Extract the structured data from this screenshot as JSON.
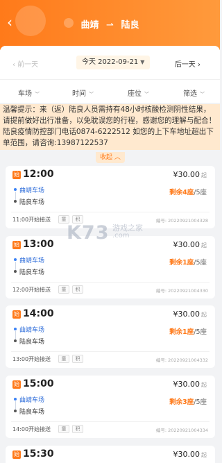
{
  "header": {
    "from_city": "曲靖",
    "arrow": "⇀",
    "to_city": "陆良",
    "back_icon": "chevron-left-icon"
  },
  "date_bar": {
    "prev": "前一天",
    "today": "今天 2022-09-21",
    "next": "后一天"
  },
  "filters": [
    "车场",
    "时间",
    "座位",
    "筛选"
  ],
  "notice": {
    "text": "温馨提示：来（返）陆良人员需持有48小时核酸检测阴性结果，请提前做好出行准备，以免耽误您的行程，感谢您的理解与配合！陆良疫情防控部门电话0874-6222512 如您的上下车地址超出下单范围，请咨询:13987122537",
    "collapse_label": "收起"
  },
  "trips": [
    {
      "badge": "始",
      "time": "12:00",
      "price": "¥30.00",
      "price_unit": "起",
      "from": "曲靖车场",
      "to": "陆良车场",
      "seats_left": "剩余4座",
      "seats_total": "/5座",
      "shuttle": "11:00开始接送",
      "tag1": "童",
      "tag2": "积",
      "code": "编号: 2022092100432​8"
    },
    {
      "badge": "始",
      "time": "13:00",
      "price": "¥30.00",
      "price_unit": "起",
      "from": "曲靖车场",
      "to": "陆良车场",
      "seats_left": "剩余1座",
      "seats_total": "/5座",
      "shuttle": "12:00开始接送",
      "tag1": "童",
      "tag2": "积",
      "code": "编号: 20220921004330"
    },
    {
      "badge": "始",
      "time": "14:00",
      "price": "¥30.00",
      "price_unit": "起",
      "from": "曲靖车场",
      "to": "陆良车场",
      "seats_left": "剩余1座",
      "seats_total": "/5座",
      "shuttle": "13:00开始接送",
      "tag1": "童",
      "tag2": "积",
      "code": "编号: 20220921004332"
    },
    {
      "badge": "始",
      "time": "15:00",
      "price": "¥30.00",
      "price_unit": "起",
      "from": "曲靖车场",
      "to": "陆良车场",
      "seats_left": "剩余3座",
      "seats_total": "/5座",
      "shuttle": "14:00开始接送",
      "tag1": "童",
      "tag2": "积",
      "code": "编号: 20220921004334"
    },
    {
      "badge": "始",
      "time": "15:30",
      "price": "¥30.00",
      "price_unit": "起",
      "from": "",
      "to": "",
      "seats_left": "",
      "seats_total": "",
      "shuttle": "",
      "tag1": "",
      "tag2": "",
      "code": ""
    }
  ],
  "watermark": {
    "logo": "K73",
    "line1": "游戏之家",
    "line2": ".com"
  },
  "colors": {
    "accent": "#ff7a1a",
    "notice_bg": "#ffe9cf",
    "link_blue": "#2a6ad9"
  }
}
